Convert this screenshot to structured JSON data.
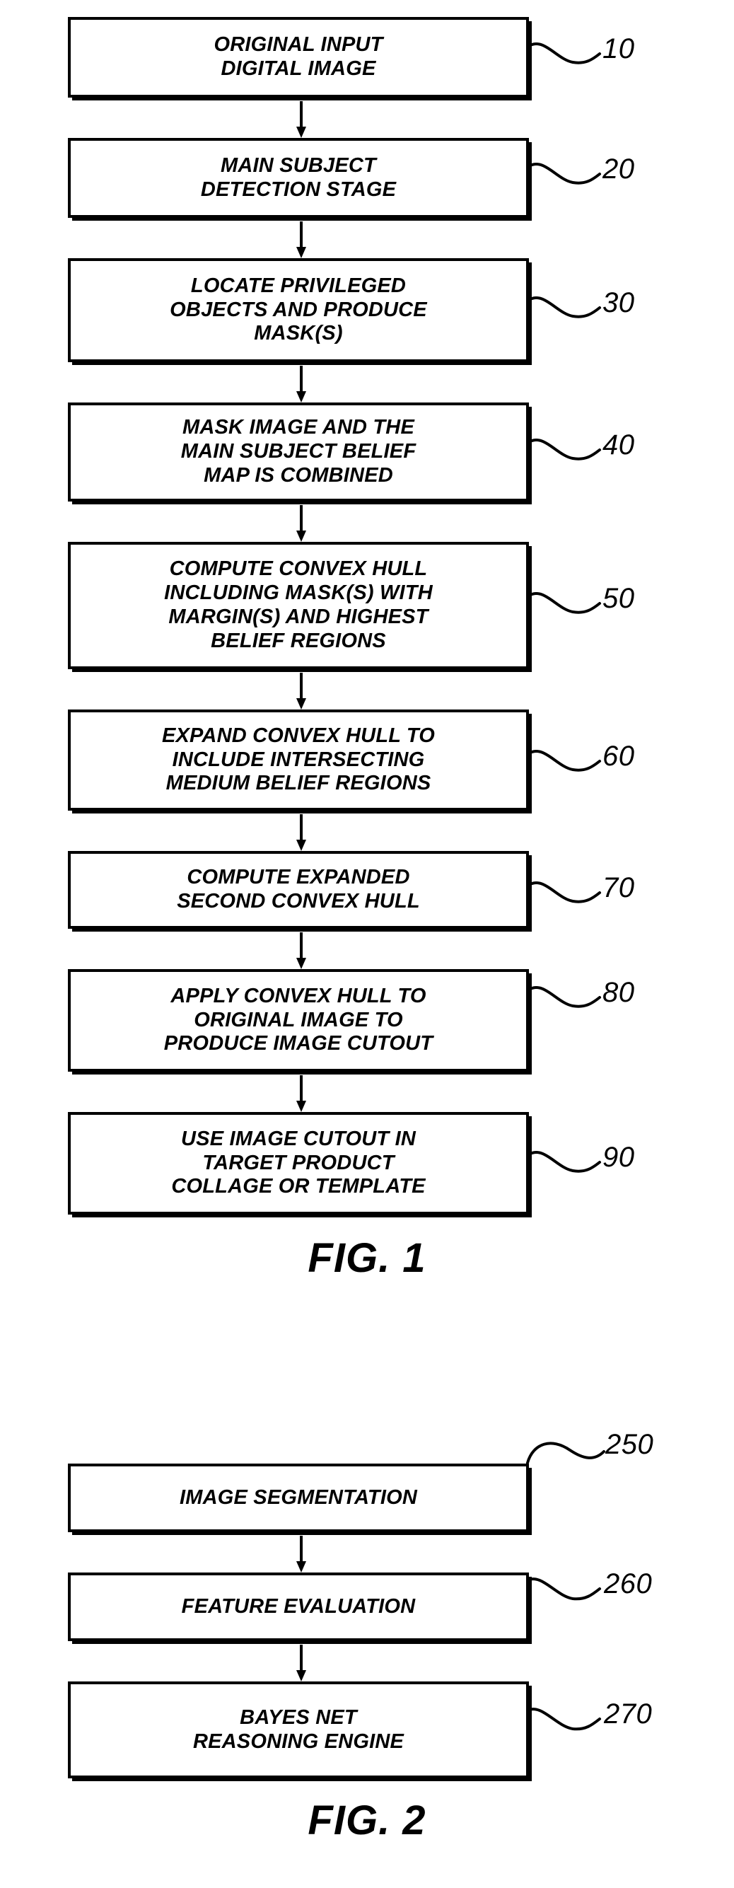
{
  "document": {
    "kind": "patent-flowchart-sheet",
    "figures": [
      {
        "id": "fig1",
        "caption": "FIG. 1",
        "steps": [
          {
            "ref": "10",
            "text": "ORIGINAL INPUT\nDIGITAL IMAGE"
          },
          {
            "ref": "20",
            "text": "MAIN SUBJECT\nDETECTION STAGE"
          },
          {
            "ref": "30",
            "text": "LOCATE PRIVILEGED\nOBJECTS AND PRODUCE\nMASK(S)"
          },
          {
            "ref": "40",
            "text": "MASK IMAGE AND THE\nMAIN SUBJECT BELIEF\nMAP IS COMBINED"
          },
          {
            "ref": "50",
            "text": "COMPUTE CONVEX HULL\nINCLUDING MASK(S) WITH\nMARGIN(S) AND HIGHEST\nBELIEF REGIONS"
          },
          {
            "ref": "60",
            "text": "EXPAND CONVEX HULL TO\nINCLUDE INTERSECTING\nMEDIUM BELIEF REGIONS"
          },
          {
            "ref": "70",
            "text": "COMPUTE EXPANDED\nSECOND CONVEX HULL"
          },
          {
            "ref": "80",
            "text": "APPLY CONVEX HULL TO\nORIGINAL IMAGE TO\nPRODUCE IMAGE CUTOUT"
          },
          {
            "ref": "90",
            "text": "USE IMAGE CUTOUT IN\nTARGET PRODUCT\nCOLLAGE OR TEMPLATE"
          }
        ]
      },
      {
        "id": "fig2",
        "caption": "FIG. 2",
        "steps": [
          {
            "ref": "250",
            "text": "IMAGE SEGMENTATION"
          },
          {
            "ref": "260",
            "text": "FEATURE EVALUATION"
          },
          {
            "ref": "270",
            "text": "BAYES NET\nREASONING ENGINE"
          }
        ]
      }
    ]
  },
  "colors": {
    "ink": "#000000",
    "paper": "#ffffff"
  }
}
